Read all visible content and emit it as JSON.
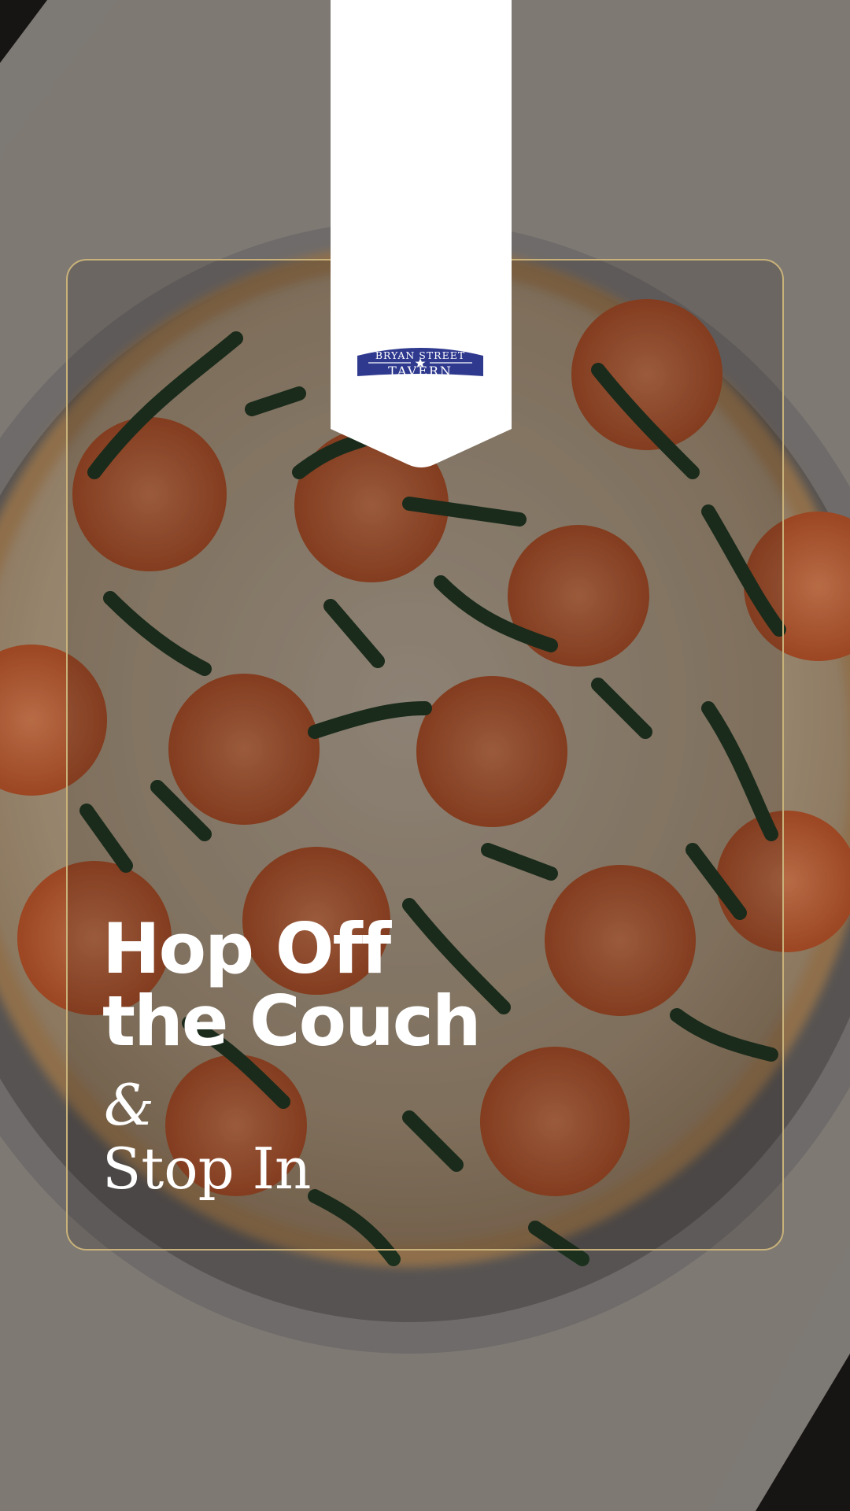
{
  "colors": {
    "card_border": "#c9b27a",
    "logo_blue": "#2f3a8f",
    "text": "#ffffff",
    "tomato": "#d8693a",
    "basil": "#274a2c",
    "cheese": "#cdb9a0"
  },
  "logo": {
    "top_text": "BRYAN STREET",
    "bottom_text": "TAVERN"
  },
  "headline": {
    "line1": "Hop Off",
    "line2": "the Couch"
  },
  "subline": {
    "ampersand": "&",
    "text": "Stop In"
  },
  "icons": [
    "star-icon"
  ]
}
